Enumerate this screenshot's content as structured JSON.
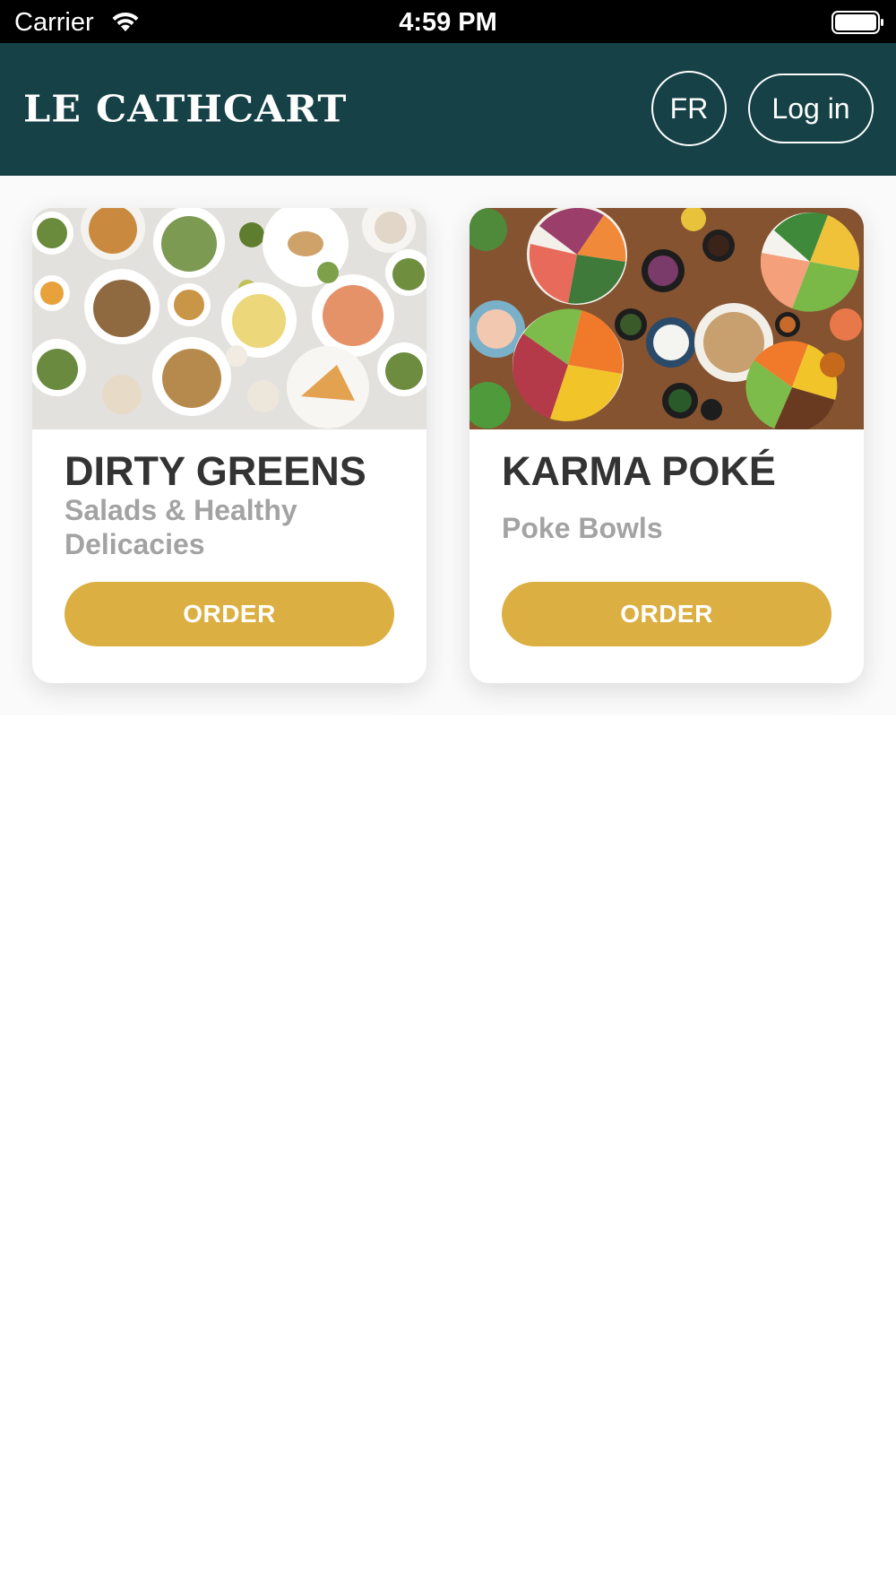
{
  "status_bar": {
    "carrier": "Carrier",
    "time": "4:59 PM",
    "wifi_icon": "wifi-icon",
    "battery_icon": "battery-icon"
  },
  "header": {
    "logo_text": "LE CATHCART",
    "language_label": "FR",
    "login_label": "Log in",
    "background_color": "#154147"
  },
  "restaurants": [
    {
      "name": "DIRTY GREENS",
      "subtitle": "Salads & Healthy Delicacies",
      "order_label": "ORDER",
      "image": "salads-photo"
    },
    {
      "name": "KARMA POKÉ",
      "subtitle": "Poke Bowls",
      "order_label": "ORDER",
      "image": "poke-bowls-photo"
    }
  ],
  "colors": {
    "accent": "#dcaf43",
    "title_text": "#333333",
    "subtitle_text": "#a3a3a3"
  }
}
